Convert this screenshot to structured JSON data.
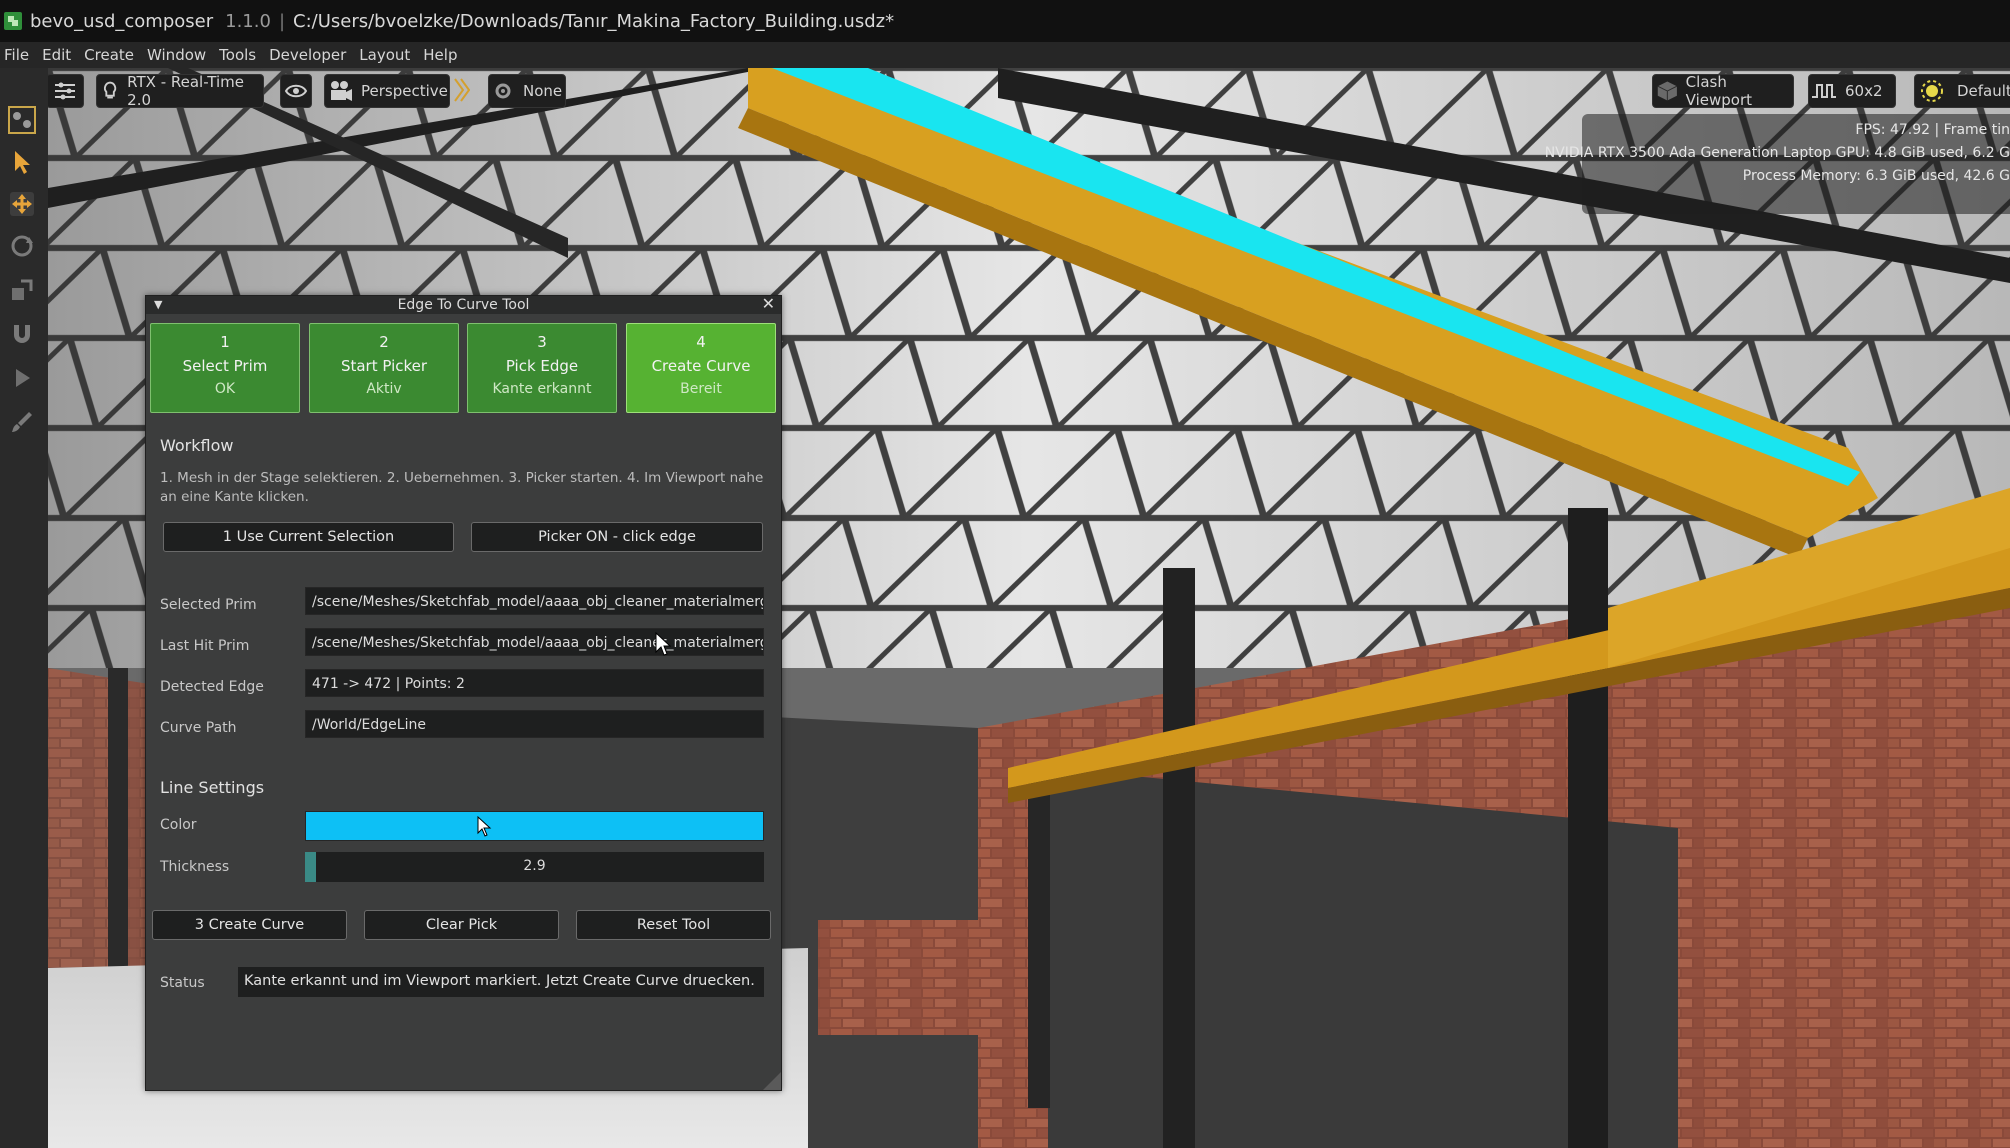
{
  "titlebar": {
    "app_name": "bevo_usd_composer",
    "version": "1.1.0",
    "separator": "|",
    "file_path": "C:/Users/bvoelzke/Downloads/Tanır_Makina_Factory_Building.usdz*"
  },
  "menu": [
    "File",
    "Edit",
    "Create",
    "Window",
    "Tools",
    "Developer",
    "Layout",
    "Help"
  ],
  "viewport": {
    "renderer_label": "RTX - Real-Time 2.0",
    "camera_label": "Perspective",
    "none_label": "None",
    "clash_label": "Clash Viewport",
    "resolution_label": "60x2",
    "default_label": "Default",
    "stats": {
      "fps": "FPS: 47.92 | Frame tin",
      "gpu": "NVIDIA RTX 3500 Ada Generation Laptop GPU: 4.8 GiB used, 6.2 G",
      "process": "Process Memory: 6.3 GiB used, 42.6 G"
    }
  },
  "tool": {
    "title": "Edge To Curve Tool",
    "steps": [
      {
        "num": "1",
        "label": "Select Prim",
        "status": "OK"
      },
      {
        "num": "2",
        "label": "Start Picker",
        "status": "Aktiv"
      },
      {
        "num": "3",
        "label": "Pick Edge",
        "status": "Kante erkannt"
      },
      {
        "num": "4",
        "label": "Create Curve",
        "status": "Bereit"
      }
    ],
    "workflow_heading": "Workflow",
    "workflow_text": "1. Mesh in der Stage selektieren. 2. Uebernehmen. 3. Picker starten. 4. Im Viewport nahe an eine Kante klicken.",
    "use_selection_button": "1  Use Current Selection",
    "picker_button": "Picker ON - click edge",
    "fields": {
      "selected_prim_label": "Selected Prim",
      "selected_prim_value": "/scene/Meshes/Sketchfab_model/aaaa_obj_cleaner_materialmerger_g",
      "last_hit_label": "Last Hit Prim",
      "last_hit_value": "/scene/Meshes/Sketchfab_model/aaaa_obj_cleaner_materialmerger_g",
      "edge_label": "Detected Edge",
      "edge_value": "471 -> 472 | Points: 2",
      "curve_path_label": "Curve Path",
      "curve_path_value": "/World/EdgeLine"
    },
    "line_settings_heading": "Line Settings",
    "color_label": "Color",
    "color_value": "#0dc0f5",
    "thickness_label": "Thickness",
    "thickness_value": "2.9",
    "thickness_fraction": 0.025,
    "create_curve_button": "3  Create Curve",
    "clear_pick_button": "Clear Pick",
    "reset_button": "Reset Tool",
    "status_label": "Status",
    "status_value": "Kante erkannt und im Viewport markiert. Jetzt Create Curve druecken."
  }
}
